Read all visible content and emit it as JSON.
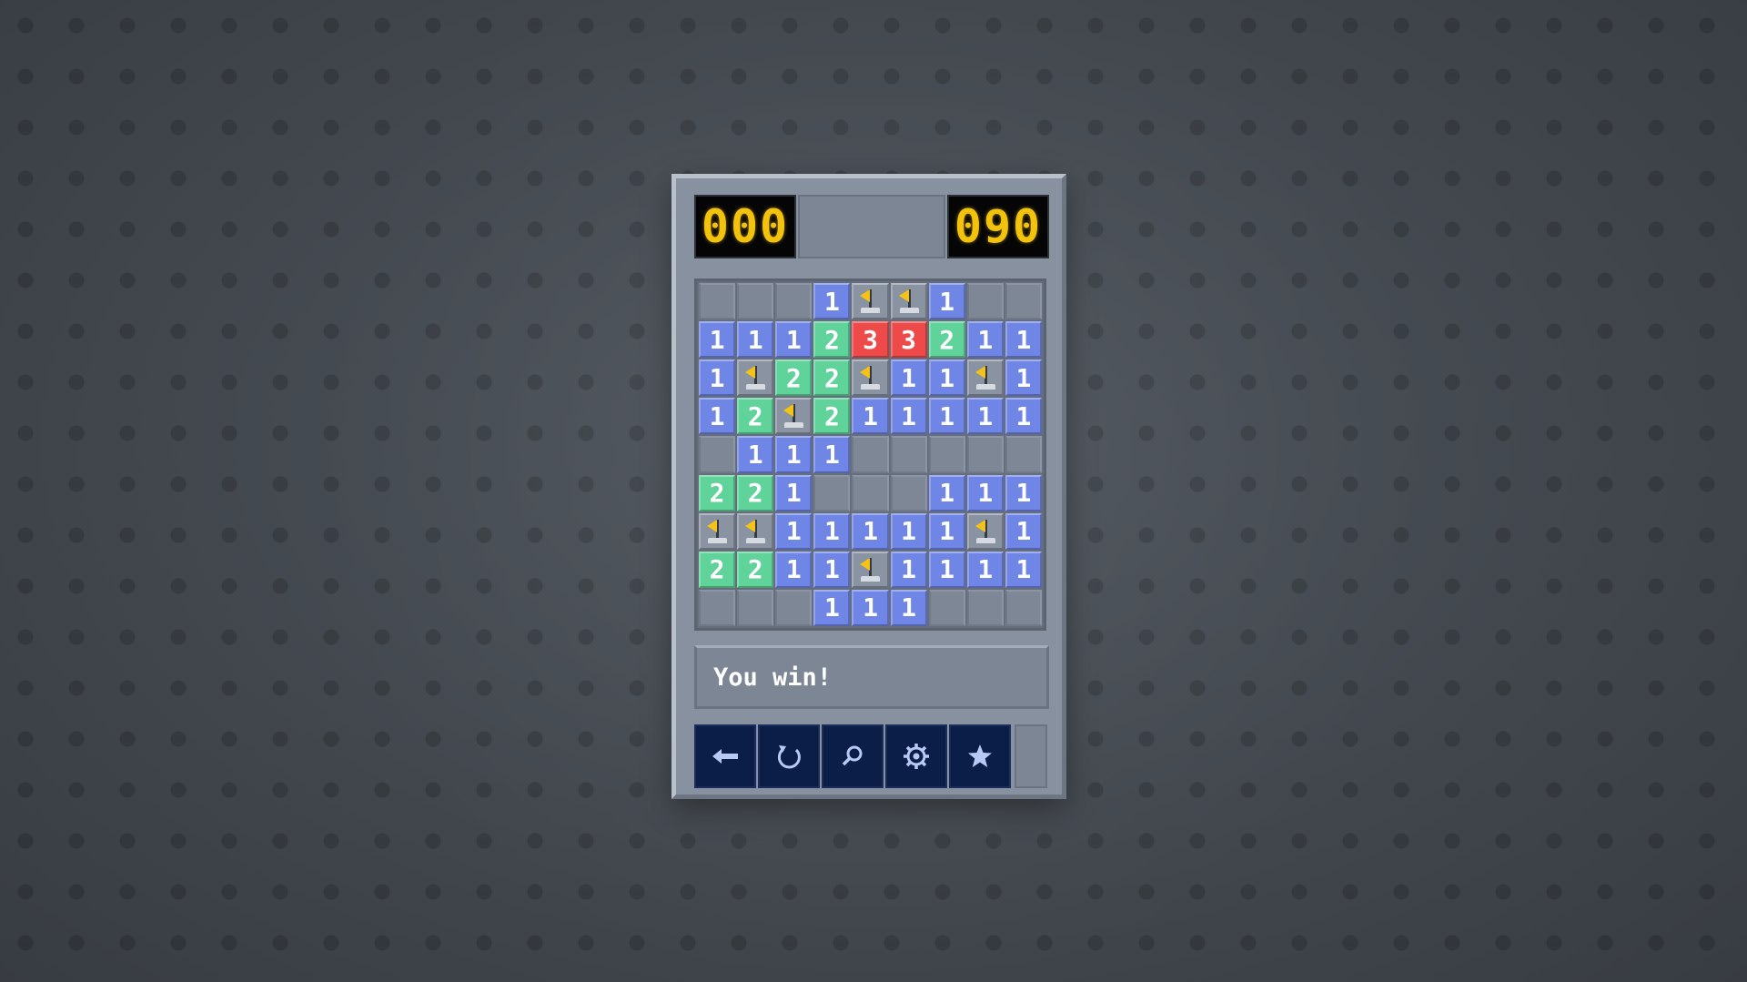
{
  "counters": {
    "mines_left": "000",
    "timer": "090"
  },
  "board": {
    "rows": [
      [
        "",
        "",
        "",
        "1",
        "F",
        "F",
        "1",
        "",
        ""
      ],
      [
        "1",
        "1",
        "1",
        "2",
        "3",
        "3",
        "2",
        "1",
        "1"
      ],
      [
        "1",
        "F",
        "2",
        "2",
        "F",
        "1",
        "1",
        "F",
        "1"
      ],
      [
        "1",
        "2",
        "F",
        "2",
        "1",
        "1",
        "1",
        "1",
        "1"
      ],
      [
        "",
        "1",
        "1",
        "1",
        "",
        "",
        "",
        "",
        ""
      ],
      [
        "2",
        "2",
        "1",
        "",
        "",
        "",
        "1",
        "1",
        "1"
      ],
      [
        "F",
        "F",
        "1",
        "1",
        "1",
        "1",
        "1",
        "F",
        "1"
      ],
      [
        "2",
        "2",
        "1",
        "1",
        "F",
        "1",
        "1",
        "1",
        "1"
      ],
      [
        "",
        "",
        "",
        "1",
        "1",
        "1",
        "",
        "",
        ""
      ]
    ]
  },
  "status_message": "You win!",
  "toolbar": {
    "buttons": [
      {
        "name": "back-button",
        "icon": "arrow-left-icon"
      },
      {
        "name": "restart-button",
        "icon": "restart-icon"
      },
      {
        "name": "hint-button",
        "icon": "magnifier-icon"
      },
      {
        "name": "settings-button",
        "icon": "gear-icon"
      },
      {
        "name": "favorites-button",
        "icon": "star-icon"
      }
    ]
  },
  "colors": {
    "number_1": "#6f86e6",
    "number_2": "#5fd39a",
    "number_3": "#ef4a4a",
    "led_digits": "#f2c20c",
    "toolbar_bg": "#0b1e47"
  }
}
